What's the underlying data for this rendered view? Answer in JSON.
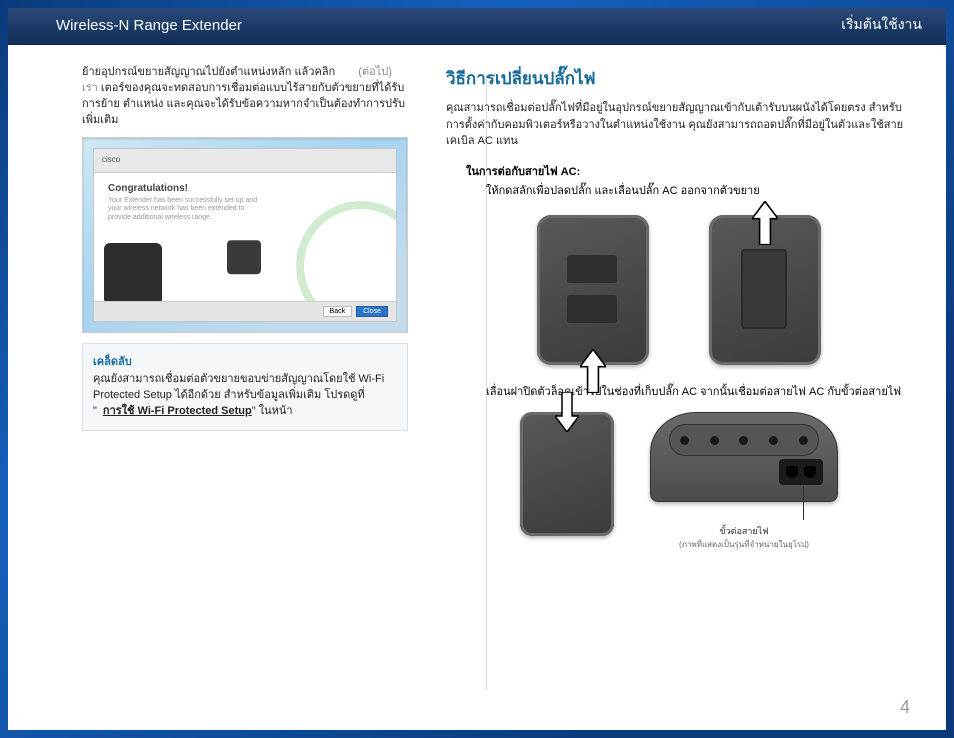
{
  "header": {
    "left": "Wireless-N Range Extender",
    "right": "เริ่มต้นใช้งาน"
  },
  "left": {
    "lead_a": "ย้ายอุปกรณ์ขยายสัญญาณไปยังตำแหน่งหลัก แล้วคลิก",
    "lead_b": "(ต่อไป) เรา",
    "lead_c": "เตอร์ของคุณจะทดสอบการเชื่อมต่อแบบไร้สายกับตัวขยายที่ได้รับการย้าย ตำแหน่ง และคุณจะได้รับข้อความหากจำเป็นต้องทำการปรับเพิ่มเติม",
    "screenshot": {
      "brand": "cisco",
      "title": "Congratulations!",
      "sub": "Your Extender has been successfully set up and your wireless network has been extended to provide additional wireless range.",
      "btn_back": "Back",
      "btn_close": "Close"
    },
    "tip_title": "เคล็ดลับ",
    "tip_body_a": "คุณยังสามารถเชื่อมต่อตัวขยายขอบข่ายสัญญาณโดยใช้ Wi-Fi Protected Setup ได้อีกด้วย สำหรับข้อมูลเพิ่มเติม โปรดดูที่",
    "tip_link": "การใช้ Wi-Fi Protected Setup",
    "tip_tail": "\" ในหน้า"
  },
  "right": {
    "heading": "วิธีการเปลี่ยนปลั๊กไฟ",
    "intro": "คุณสามารถเชื่อมต่อปลั๊กไฟที่มีอยู่ในอุปกรณ์ขยายสัญญาณเข้ากับเต้ารับบนผนังได้โดยตรง สำหรับการตั้งค่ากับคอมพิวเตอร์หรือวางในตำแหน่งใช้งาน คุณยังสามารถถอดปลั๊กที่มีอยู่ในตัวและใช้สายเคเบิล AC แทน",
    "sub": "ในการต่อกับสายไฟ AC:",
    "step1": "ให้กดสลักเพื่อปลดปลั๊ก และเลื่อนปลั๊ก AC ออกจากตัวขยาย",
    "step2": "เลื่อนฝาปิดตัวล็อคเข้าไปในช่องที่เก็บปลั๊ก AC จากนั้นเชื่อมต่อสายไฟ AC กับขั้วต่อสายไฟ",
    "caption_title": "ขั้วต่อสายไฟ",
    "caption_sub": "(ภาพที่แสดงเป็นรุ่นที่จำหน่ายในยุโรป)"
  },
  "page_number": "4"
}
